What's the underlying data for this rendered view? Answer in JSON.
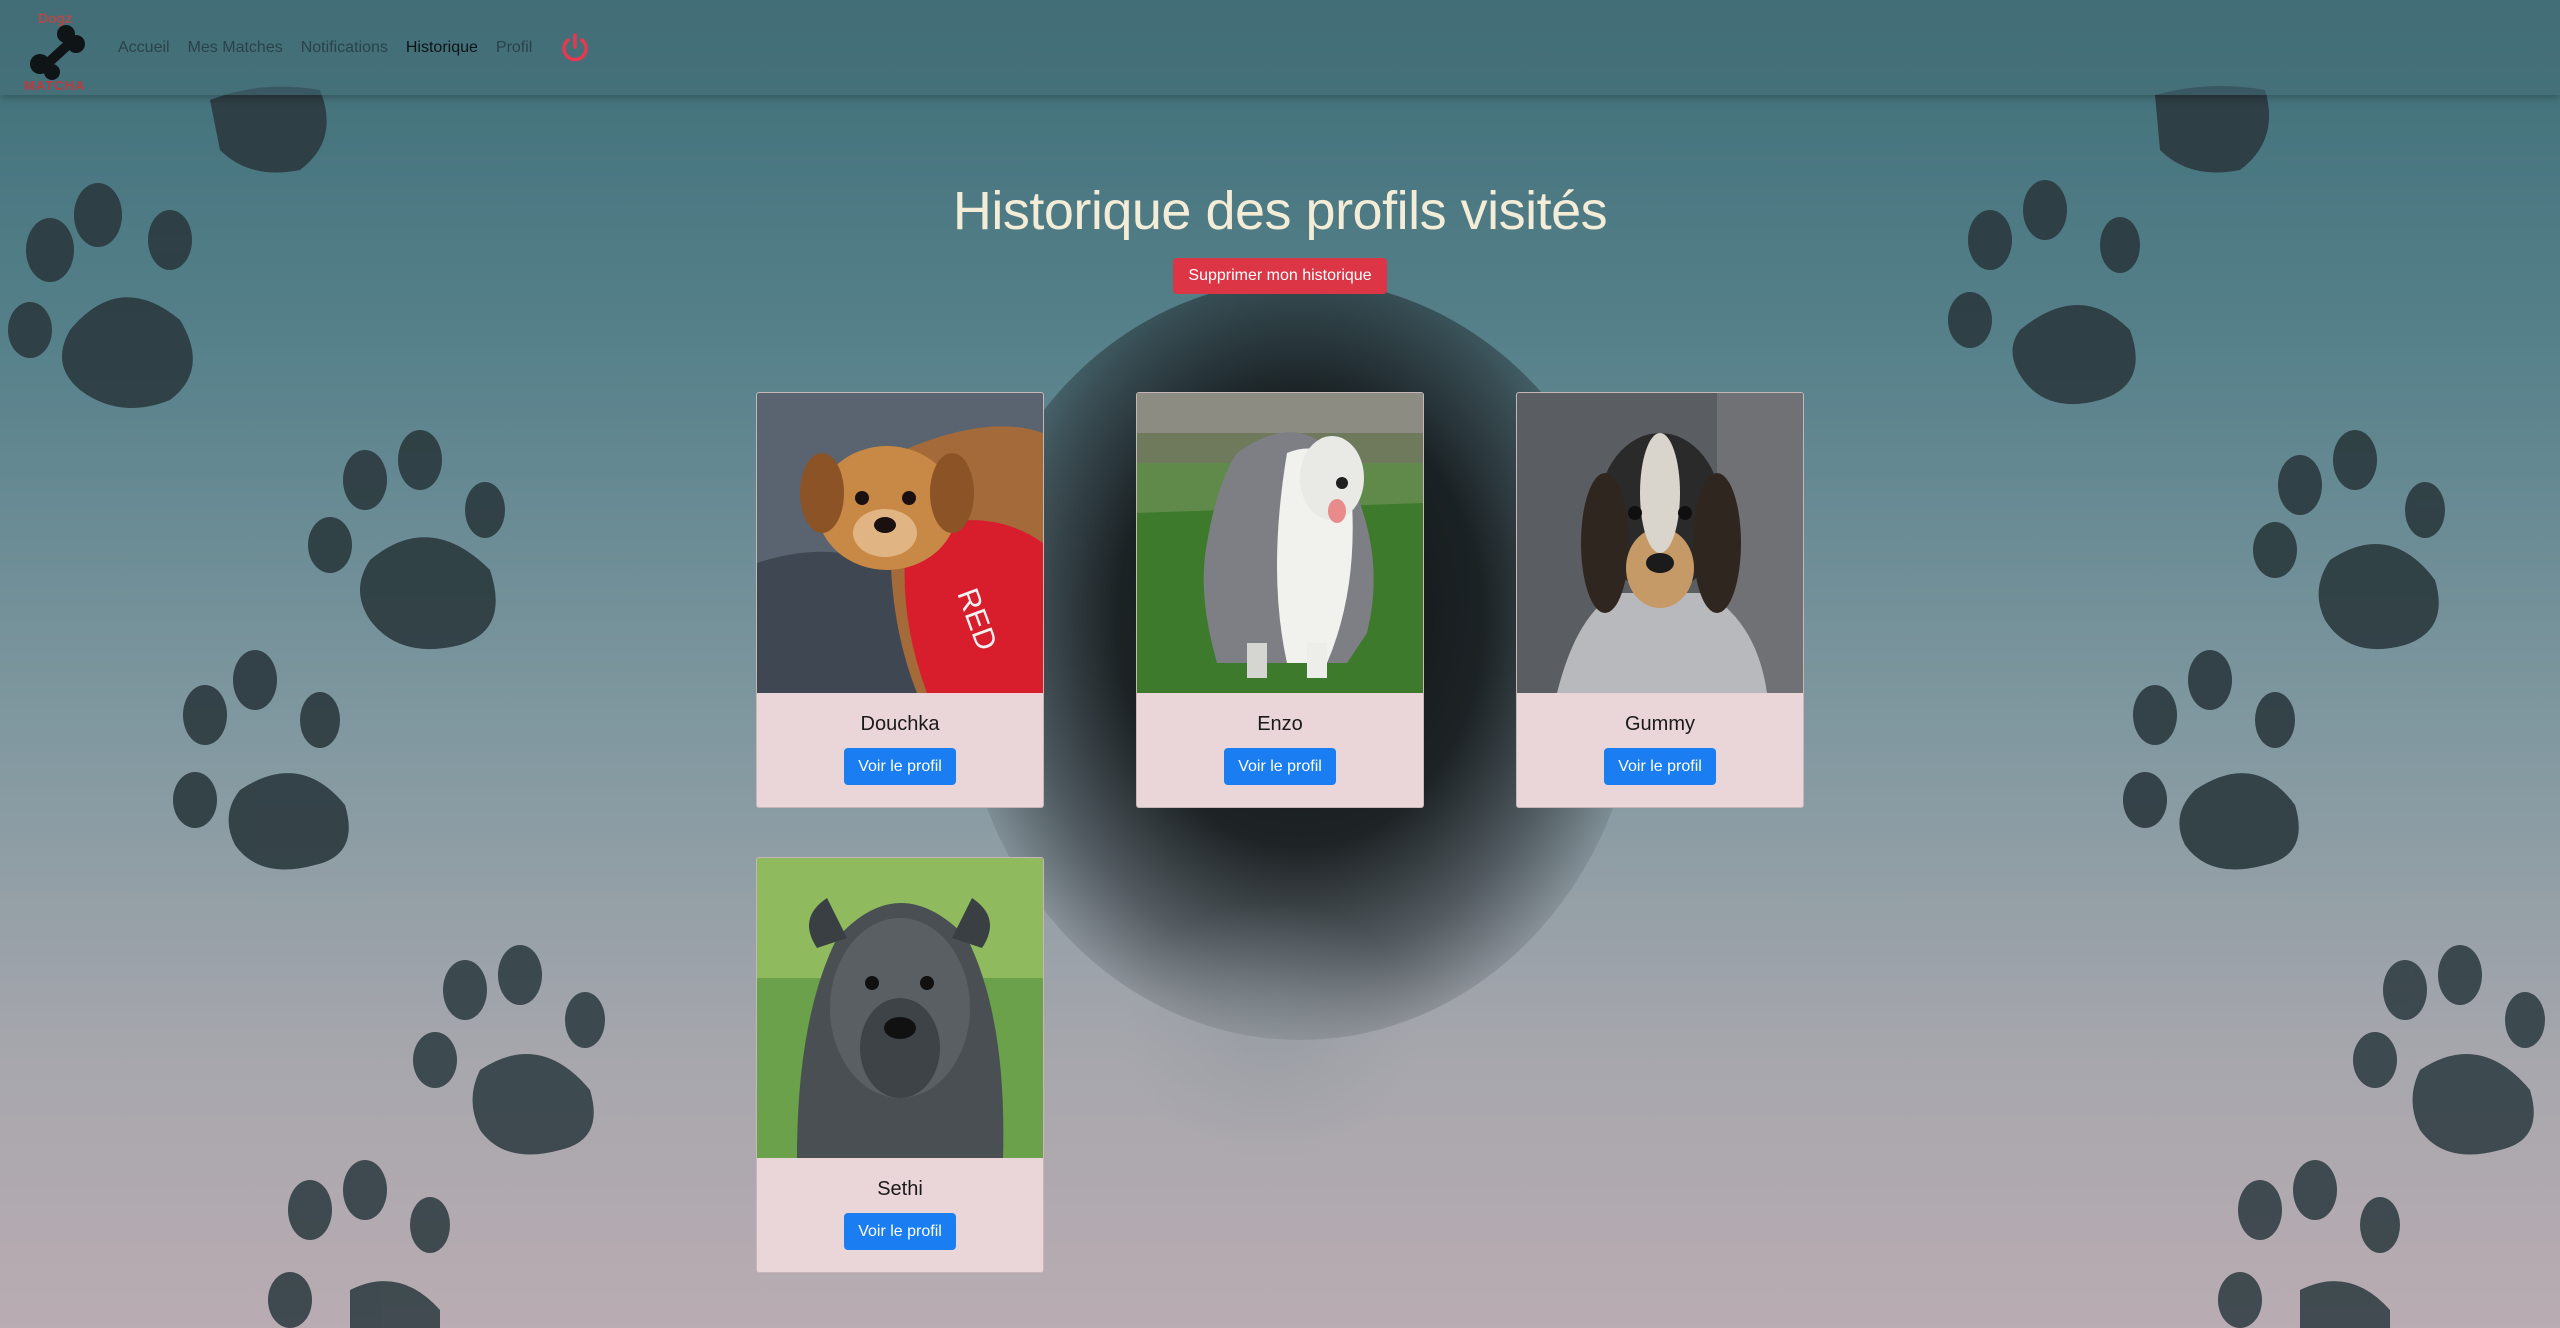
{
  "brand": {
    "top_text": "Dogz",
    "bottom_text": "MATCHA"
  },
  "nav": {
    "items": [
      {
        "label": "Accueil",
        "active": false
      },
      {
        "label": "Mes Matches",
        "active": false
      },
      {
        "label": "Notifications",
        "active": false
      },
      {
        "label": "Historique",
        "active": true
      },
      {
        "label": "Profil",
        "active": false
      }
    ],
    "logout_icon": "power-icon",
    "logout_color": "#e8384f"
  },
  "page": {
    "title": "Historique des profils visités",
    "clear_button": "Supprimer mon historique"
  },
  "profiles": [
    {
      "name": "Douchka",
      "button": "Voir le profil",
      "photo": "dog-photo-icon"
    },
    {
      "name": "Enzo",
      "button": "Voir le profil",
      "photo": "dog-photo-icon"
    },
    {
      "name": "Gummy",
      "button": "Voir le profil",
      "photo": "dog-photo-icon"
    },
    {
      "name": "Sethi",
      "button": "Voir le profil",
      "photo": "dog-photo-icon"
    }
  ],
  "colors": {
    "danger": "#dc3545",
    "primary": "#1a7ef2",
    "card_bg": "#ead5d8",
    "title": "#f3ecd7"
  }
}
